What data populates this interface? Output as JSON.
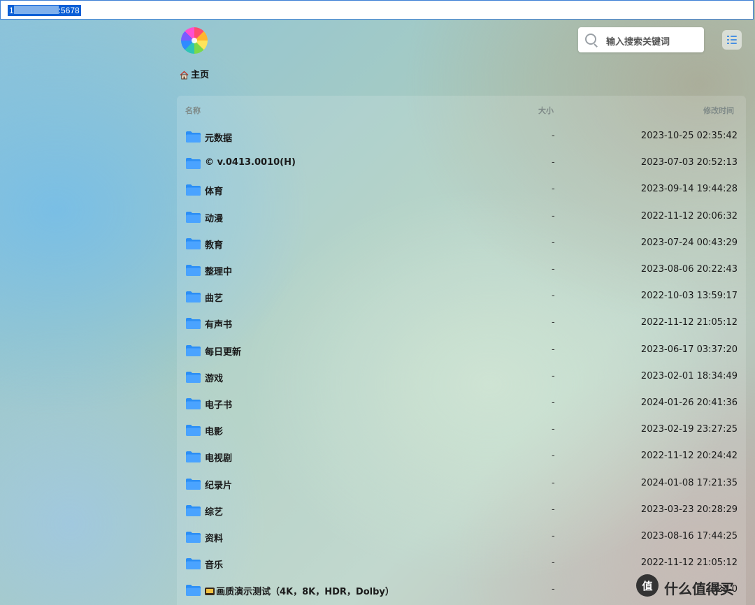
{
  "browser": {
    "url_prefix": "1",
    "url_suffix": ":5678"
  },
  "search": {
    "placeholder": "输入搜索关键词"
  },
  "breadcrumb": {
    "home_label": "主页"
  },
  "table": {
    "headers": {
      "name": "名称",
      "size": "大小",
      "modified": "修改时间"
    },
    "rows": [
      {
        "name": "元数据",
        "size": "-",
        "modified": "2023-10-25 02:35:42"
      },
      {
        "name": "© v.0413.0010(H)",
        "size": "-",
        "modified": "2023-07-03 20:52:13"
      },
      {
        "name": "体育",
        "size": "-",
        "modified": "2023-09-14 19:44:28"
      },
      {
        "name": "动漫",
        "size": "-",
        "modified": "2022-11-12 20:06:32"
      },
      {
        "name": "教育",
        "size": "-",
        "modified": "2023-07-24 00:43:29"
      },
      {
        "name": "整理中",
        "size": "-",
        "modified": "2023-08-06 20:22:43"
      },
      {
        "name": "曲艺",
        "size": "-",
        "modified": "2022-10-03 13:59:17"
      },
      {
        "name": "有声书",
        "size": "-",
        "modified": "2022-11-12 21:05:12"
      },
      {
        "name": "每日更新",
        "size": "-",
        "modified": "2023-06-17 03:37:20"
      },
      {
        "name": "游戏",
        "size": "-",
        "modified": "2023-02-01 18:34:49"
      },
      {
        "name": "电子书",
        "size": "-",
        "modified": "2024-01-26 20:41:36"
      },
      {
        "name": "电影",
        "size": "-",
        "modified": "2023-02-19 23:27:25"
      },
      {
        "name": "电视剧",
        "size": "-",
        "modified": "2022-11-12 20:24:42"
      },
      {
        "name": "纪录片",
        "size": "-",
        "modified": "2024-01-08 17:21:35"
      },
      {
        "name": "综艺",
        "size": "-",
        "modified": "2023-03-23 20:28:29"
      },
      {
        "name": "资料",
        "size": "-",
        "modified": "2023-08-16 17:44:25"
      },
      {
        "name": "音乐",
        "size": "-",
        "modified": "2022-11-12 21:05:12"
      },
      {
        "name": "画质演示测试（4K，8K，HDR，Dolby）",
        "size": "-",
        "modified": "2023-0"
      }
    ]
  },
  "watermark": {
    "text": "什么值得买"
  },
  "colors": {
    "folder": "#2b8ef5",
    "accent": "#4a90e2"
  }
}
